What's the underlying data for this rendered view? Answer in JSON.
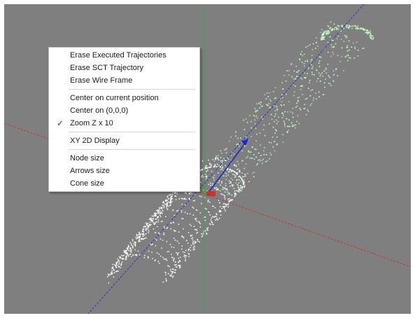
{
  "menu": {
    "items": [
      {
        "label": "Erase Executed Trajectories",
        "checked": false
      },
      {
        "label": "Erase SCT Trajectory",
        "checked": false
      },
      {
        "label": "Erase Wire Frame",
        "checked": false
      },
      {
        "separator": true
      },
      {
        "label": "Center on current position",
        "checked": false
      },
      {
        "label": "Center on (0,0,0)",
        "checked": false
      },
      {
        "label": "Zoom Z x 10",
        "checked": true
      },
      {
        "separator": true
      },
      {
        "label": "XY 2D Display",
        "checked": false
      },
      {
        "separator": true
      },
      {
        "label": "Node size",
        "checked": false
      },
      {
        "label": "Arrows size",
        "checked": false
      },
      {
        "label": "Cone size",
        "checked": false
      }
    ],
    "check_glyph": "✓"
  },
  "colors": {
    "background": "#7f7f7f",
    "x_axis": "#c83232",
    "y_axis": "#3aa83a",
    "z_axis": "#2b2bd0",
    "sct_trajectory": "#c8ffc8",
    "executed_trajectory": "#ffffff",
    "arrow": "#1f1fd6"
  }
}
